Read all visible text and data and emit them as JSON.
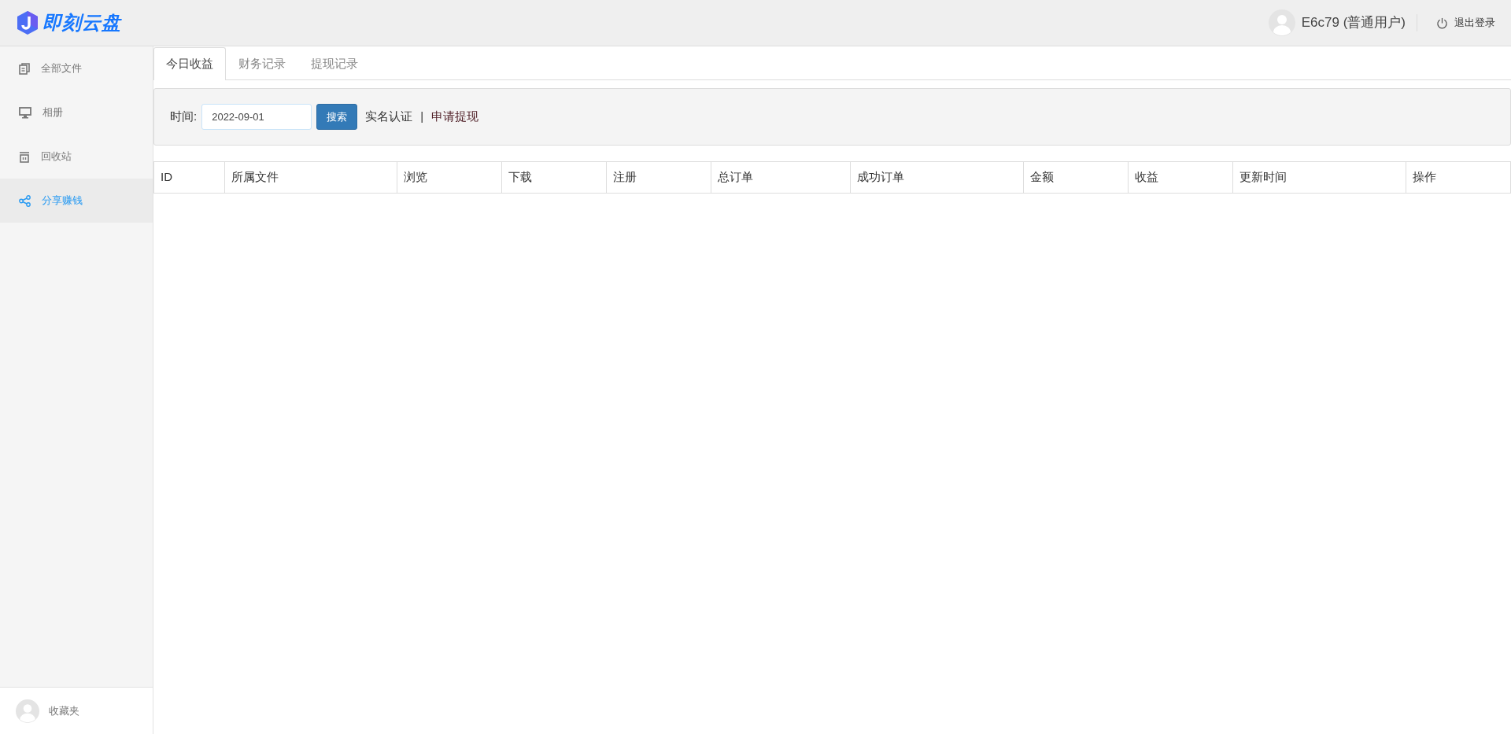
{
  "header": {
    "logo_text": "即刻云盘",
    "user": "E6c79 (普通用户)",
    "logout": "退出登录"
  },
  "sidebar": {
    "items": [
      {
        "label": "全部文件",
        "kind": "files",
        "selected": false
      },
      {
        "label": "相册",
        "kind": "monitor",
        "selected": false
      },
      {
        "label": "回收站",
        "kind": "trash",
        "selected": false
      },
      {
        "label": "分享赚钱",
        "kind": "share",
        "selected": true
      }
    ],
    "footer": "收藏夹"
  },
  "tabs": [
    {
      "label": "今日收益",
      "selected": true
    },
    {
      "label": "财务记录",
      "selected": false
    },
    {
      "label": "提现记录",
      "selected": false
    }
  ],
  "filter": {
    "label": "时间:",
    "date": "2022-09-01",
    "search_button": "搜索",
    "links": [
      "实名认证",
      "申请提现"
    ],
    "separator": "|"
  },
  "table": {
    "columns": [
      "ID",
      "所属文件",
      "浏览",
      "下载",
      "注册",
      "总订单",
      "成功订单",
      "金额",
      "收益",
      "更新时间",
      "操作"
    ]
  }
}
